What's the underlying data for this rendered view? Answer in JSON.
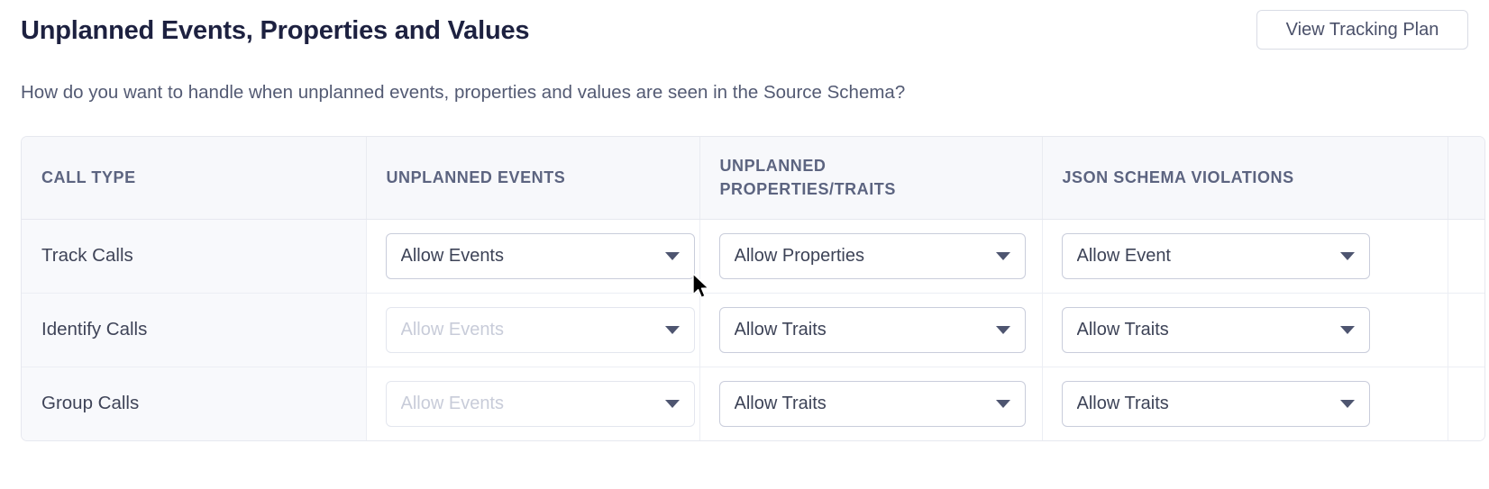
{
  "header": {
    "title": "Unplanned Events, Properties and Values",
    "action_button": "View Tracking Plan"
  },
  "subtitle": "How do you want to handle when unplanned events, properties and values are seen in the Source Schema?",
  "table": {
    "columns": [
      {
        "id": "call_type",
        "label": "CALL TYPE",
        "lines": [
          "CALL TYPE"
        ]
      },
      {
        "id": "unplanned_events",
        "label": "UNPLANNED EVENTS",
        "lines": [
          "UNPLANNED EVENTS"
        ]
      },
      {
        "id": "unplanned_properties",
        "label": "UNPLANNED PROPERTIES/TRAITS",
        "lines": [
          "UNPLANNED",
          "PROPERTIES/TRAITS"
        ]
      },
      {
        "id": "json_schema_violations",
        "label": "JSON SCHEMA VIOLATIONS",
        "lines": [
          "JSON SCHEMA VIOLATIONS"
        ]
      }
    ],
    "rows": [
      {
        "call_type": "Track Calls",
        "unplanned_events": {
          "value": "Allow Events",
          "disabled": false
        },
        "unplanned_properties": {
          "value": "Allow Properties",
          "disabled": false
        },
        "json_schema_violations": {
          "value": "Allow Event",
          "disabled": false
        }
      },
      {
        "call_type": "Identify Calls",
        "unplanned_events": {
          "value": "Allow Events",
          "disabled": true
        },
        "unplanned_properties": {
          "value": "Allow Traits",
          "disabled": false
        },
        "json_schema_violations": {
          "value": "Allow Traits",
          "disabled": false
        }
      },
      {
        "call_type": "Group Calls",
        "unplanned_events": {
          "value": "Allow Events",
          "disabled": true
        },
        "unplanned_properties": {
          "value": "Allow Traits",
          "disabled": false
        },
        "json_schema_violations": {
          "value": "Allow Traits",
          "disabled": false
        }
      }
    ]
  },
  "icons": {
    "dropdown_arrow": "chevron-down-icon",
    "pointer": "mouse-pointer-icon"
  },
  "colors": {
    "title": "#1d2140",
    "body_text": "#535a73",
    "header_cell_bg": "#f7f8fb",
    "first_column_bg": "#f8f9fc",
    "border": "#e6e8ef",
    "dropdown_border": "#c9cddb",
    "disabled_text": "#c8ccd9"
  }
}
